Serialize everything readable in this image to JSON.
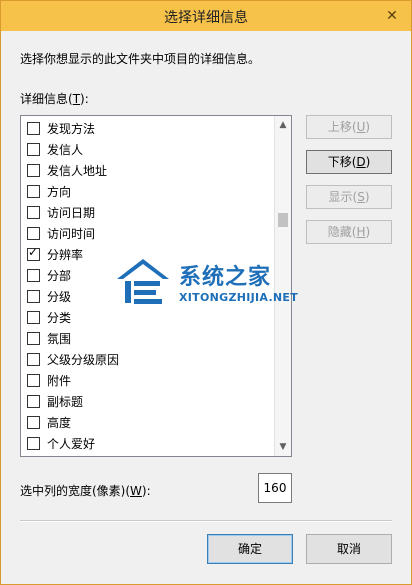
{
  "dialog": {
    "title": "选择详细信息",
    "description": "选择你想显示的此文件夹中项目的详细信息。",
    "list_label": {
      "text": "详细信息(",
      "key": "T",
      "suffix": "):"
    },
    "items": [
      {
        "label": "发现方法",
        "checked": false
      },
      {
        "label": "发信人",
        "checked": false
      },
      {
        "label": "发信人地址",
        "checked": false
      },
      {
        "label": "方向",
        "checked": false
      },
      {
        "label": "访问日期",
        "checked": false
      },
      {
        "label": "访问时间",
        "checked": false
      },
      {
        "label": "分辨率",
        "checked": true
      },
      {
        "label": "分部",
        "checked": false
      },
      {
        "label": "分级",
        "checked": false
      },
      {
        "label": "分类",
        "checked": false
      },
      {
        "label": "氛围",
        "checked": false
      },
      {
        "label": "父级分级原因",
        "checked": false
      },
      {
        "label": "附件",
        "checked": false
      },
      {
        "label": "副标题",
        "checked": false
      },
      {
        "label": "高度",
        "checked": false
      },
      {
        "label": "个人爱好",
        "checked": false
      }
    ],
    "buttons": {
      "move_up": {
        "text": "上移(",
        "key": "U",
        "suffix": ")",
        "enabled": false
      },
      "move_down": {
        "text": "下移(",
        "key": "D",
        "suffix": ")",
        "enabled": true
      },
      "show": {
        "text": "显示(",
        "key": "S",
        "suffix": ")",
        "enabled": false
      },
      "hide": {
        "text": "隐藏(",
        "key": "H",
        "suffix": ")",
        "enabled": false
      }
    },
    "width": {
      "label_text": "选中列的宽度(像素)(",
      "key": "W",
      "label_suffix": "):",
      "value": "160"
    },
    "ok": "确定",
    "cancel": "取消"
  },
  "watermark": {
    "title": "系统之家",
    "subtitle": "XITONGZHIJIA.NET"
  },
  "colors": {
    "titlebar": "#f7c24a",
    "border": "#d99a2e",
    "watermark": "#1e6fb8"
  },
  "icons": {
    "close": "close-icon",
    "scroll_up": "chevron-up-icon",
    "scroll_down": "chevron-down-icon",
    "checkmark": "check-icon"
  }
}
